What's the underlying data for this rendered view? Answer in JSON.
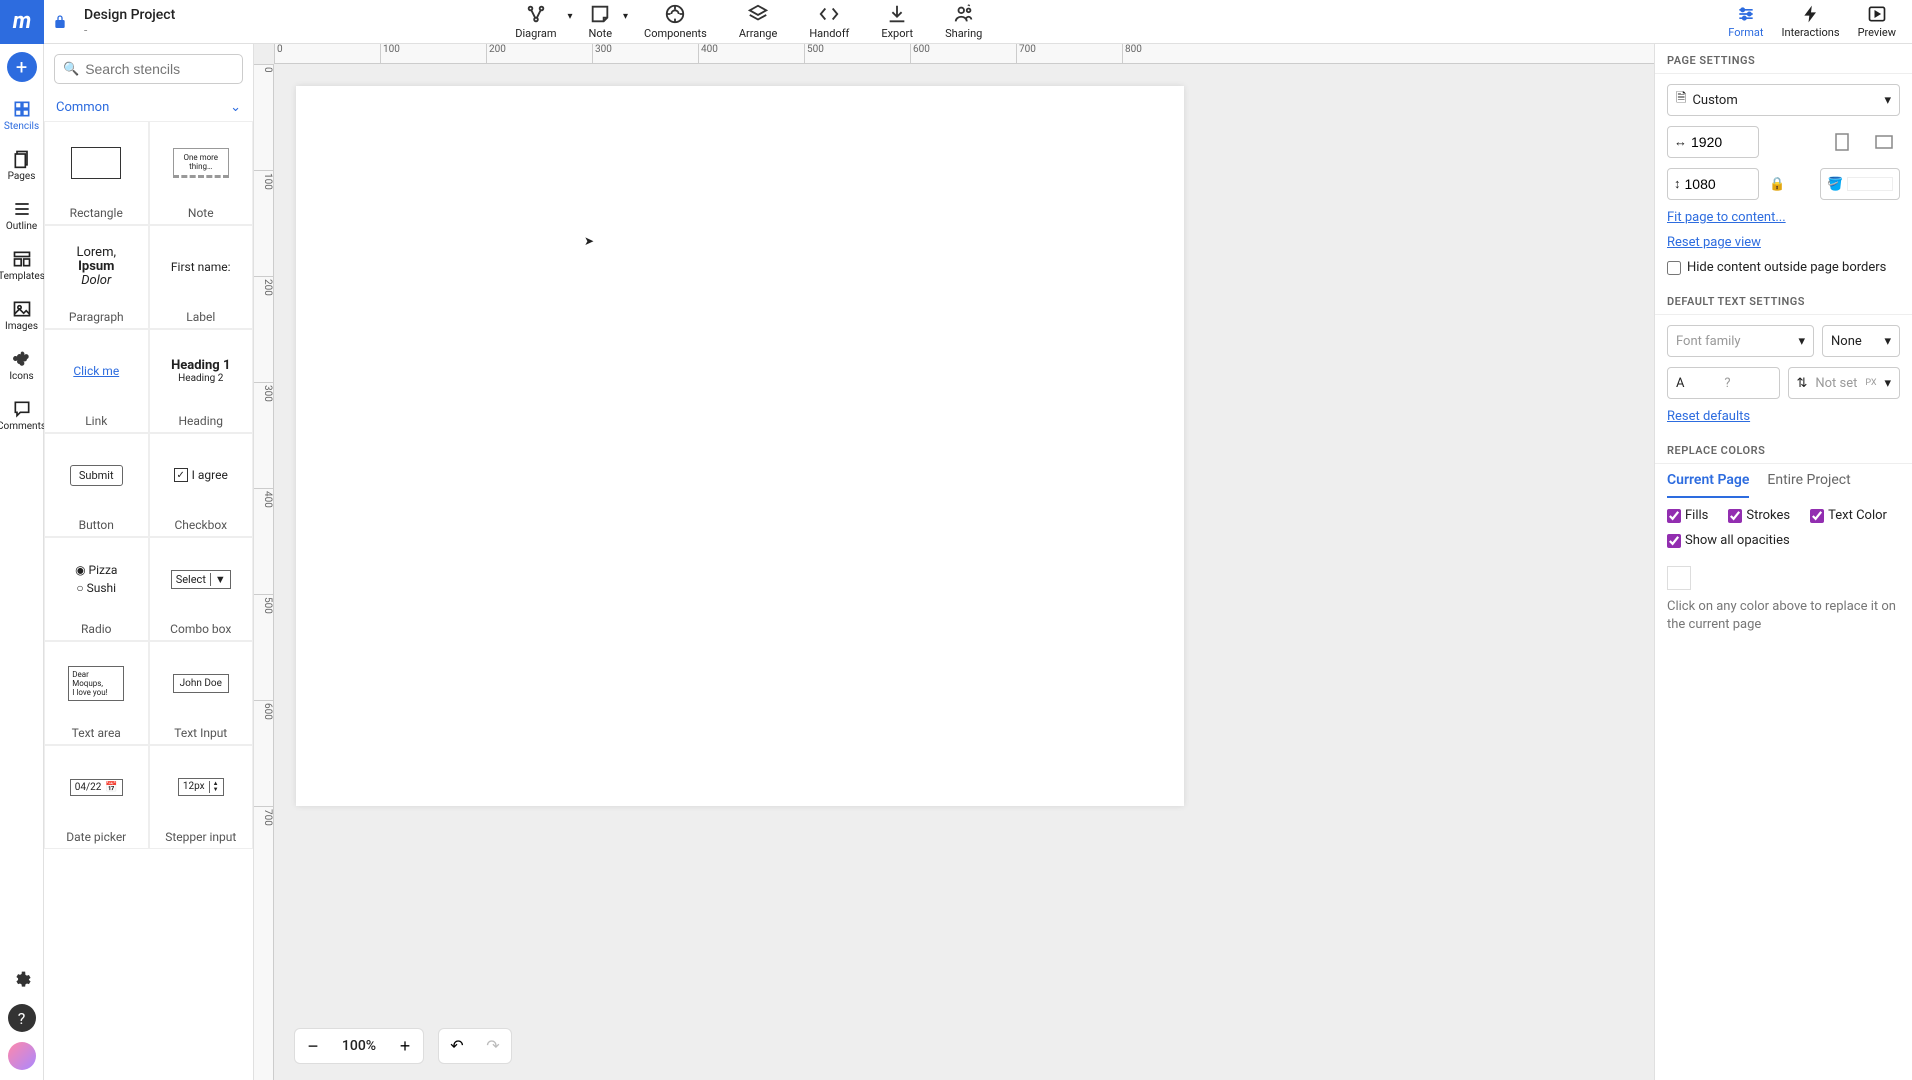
{
  "header": {
    "title": "Design Project",
    "subtitle": "-"
  },
  "toolbar": {
    "diagram": "Diagram",
    "note": "Note",
    "components": "Components",
    "arrange": "Arrange",
    "handoff": "Handoff",
    "export": "Export",
    "sharing": "Sharing"
  },
  "rightTabs": {
    "format": "Format",
    "interactions": "Interactions",
    "preview": "Preview"
  },
  "rail": {
    "stencils": "Stencils",
    "pages": "Pages",
    "outline": "Outline",
    "templates": "Templates",
    "images": "Images",
    "icons": "Icons",
    "comments": "Comments"
  },
  "stencils": {
    "search_placeholder": "Search stencils",
    "category": "Common",
    "items": [
      "Rectangle",
      "Note",
      "Paragraph",
      "Label",
      "Link",
      "Heading",
      "Button",
      "Checkbox",
      "Radio",
      "Combo box",
      "Text area",
      "Text Input",
      "Date picker",
      "Stepper input"
    ],
    "previews": {
      "note": "One more thing…",
      "paragraph_1": "Lorem,",
      "paragraph_2": "Ipsum",
      "paragraph_3": "Dolor",
      "label": "First name:",
      "link": "Click me",
      "heading_1": "Heading 1",
      "heading_2": "Heading 2",
      "button": "Submit",
      "checkbox": "I agree",
      "radio_1": "Pizza",
      "radio_2": "Sushi",
      "select": "Select",
      "textarea_1": "Dear Moqups,",
      "textarea_2": "I love you!",
      "textinput": "John Doe",
      "date": "04/22",
      "stepper": "12px"
    }
  },
  "rulerH": [
    "0",
    "100",
    "200",
    "300",
    "400",
    "500",
    "600",
    "700",
    "800"
  ],
  "rulerV": [
    "0",
    "100",
    "200",
    "300",
    "400",
    "500",
    "600",
    "700"
  ],
  "zoom": {
    "value": "100%"
  },
  "pageSettings": {
    "title": "PAGE SETTINGS",
    "preset": "Custom",
    "width": "1920",
    "height": "1080",
    "fit_link": "Fit page to content...",
    "reset_link": "Reset page view",
    "hide_chk": "Hide content outside page borders"
  },
  "textSettings": {
    "title": "DEFAULT TEXT SETTINGS",
    "font_placeholder": "Font family",
    "weight": "None",
    "size_placeholder": "?",
    "lineheight": "Not set",
    "lh_unit": "PX",
    "reset_link": "Reset defaults"
  },
  "replaceColors": {
    "title": "REPLACE COLORS",
    "tab_current": "Current Page",
    "tab_project": "Entire Project",
    "chk_fills": "Fills",
    "chk_strokes": "Strokes",
    "chk_text": "Text Color",
    "chk_opac": "Show all opacities",
    "hint": "Click on any color above to replace it on the current page"
  }
}
